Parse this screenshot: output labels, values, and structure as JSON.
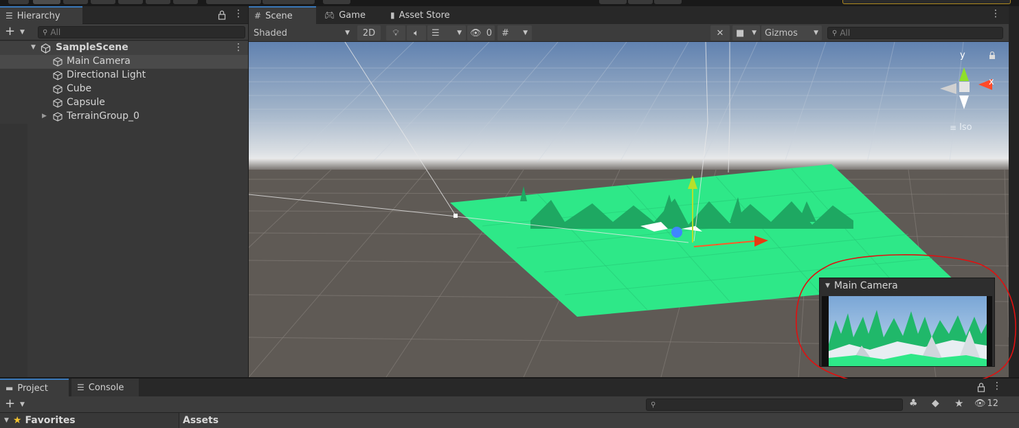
{
  "hierarchy": {
    "tab_label": "Hierarchy",
    "search_placeholder": "All",
    "scene_name": "SampleScene",
    "items": [
      {
        "label": "Main Camera"
      },
      {
        "label": "Directional Light"
      },
      {
        "label": "Cube"
      },
      {
        "label": "Capsule"
      },
      {
        "label": "TerrainGroup_0"
      }
    ]
  },
  "scene_tabs": [
    {
      "label": "Scene"
    },
    {
      "label": "Game"
    },
    {
      "label": "Asset Store"
    }
  ],
  "scene_toolbar": {
    "shading_mode": "Shaded",
    "mode_2d": "2D",
    "hidden_count": "0",
    "gizmos_label": "Gizmos",
    "search_placeholder": "All"
  },
  "orientation_gizmo": {
    "y_label": "y",
    "x_label": "x",
    "projection_label": "Iso"
  },
  "camera_preview": {
    "title": "Main Camera"
  },
  "bottom": {
    "tabs": [
      {
        "label": "Project"
      },
      {
        "label": "Console"
      }
    ],
    "hidden_count": "12",
    "favorites_label": "Favorites",
    "assets_label": "Assets"
  },
  "colors": {
    "accent": "#3a79bb",
    "terrain": "#2ee888",
    "annotation": "#e01010",
    "sky_top": "#5a7fb0",
    "ground": "#5f5a55"
  }
}
